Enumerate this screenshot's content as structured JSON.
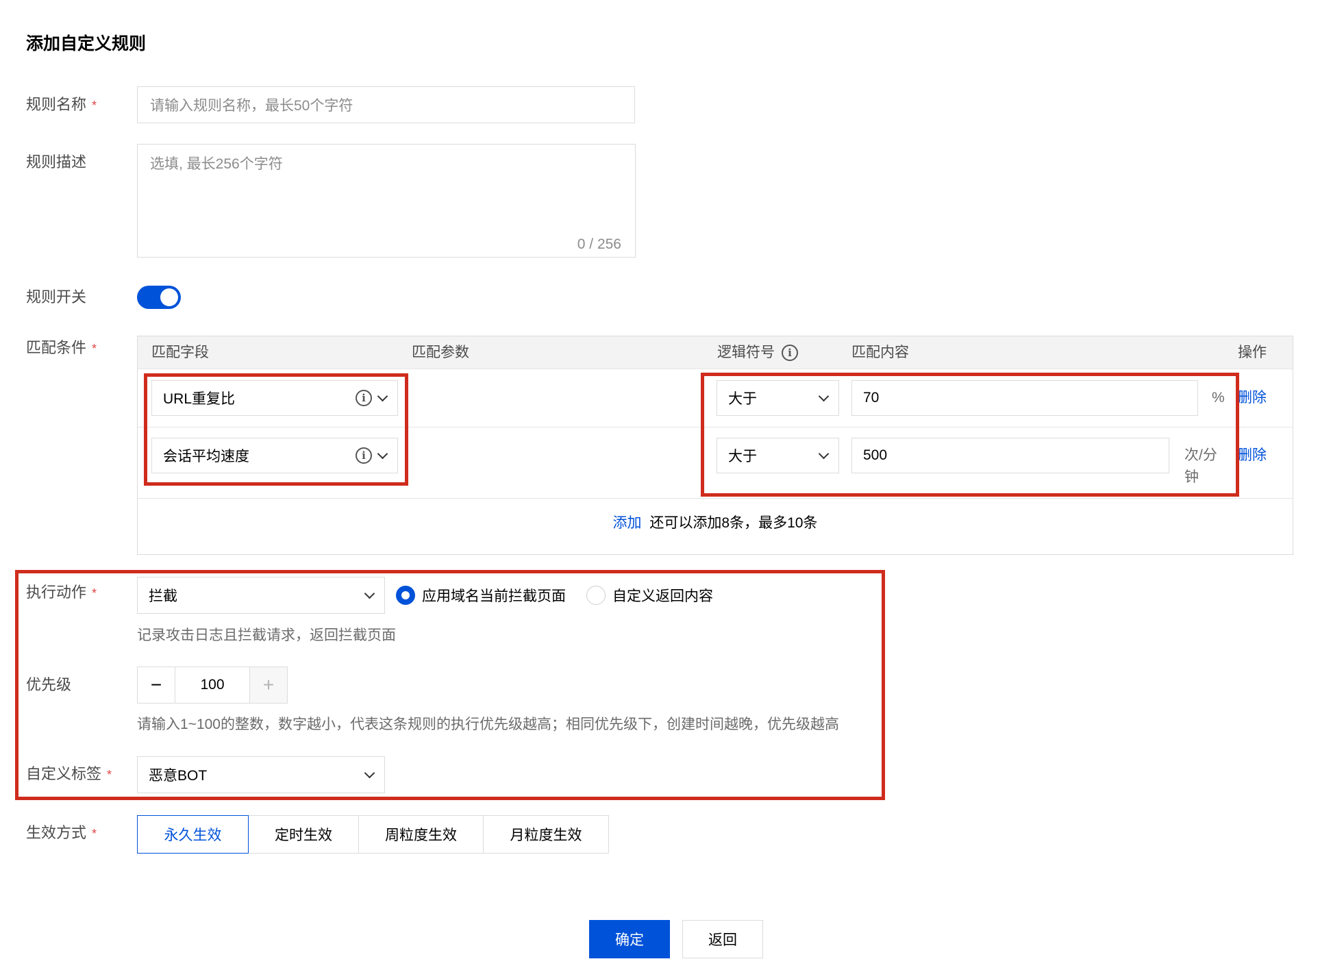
{
  "page": {
    "title": "添加自定义规则"
  },
  "form": {
    "required_mark": "*",
    "rule_name": {
      "label": "规则名称",
      "placeholder": "请输入规则名称，最长50个字符",
      "value": ""
    },
    "rule_desc": {
      "label": "规则描述",
      "placeholder": "选填, 最长256个字符",
      "counter": "0 / 256"
    },
    "rule_switch": {
      "label": "规则开关",
      "on": true
    },
    "match": {
      "label": "匹配条件",
      "columns": {
        "field": "匹配字段",
        "param": "匹配参数",
        "operator": "逻辑符号",
        "content": "匹配内容",
        "action": "操作"
      },
      "rows": [
        {
          "field": "URL重复比",
          "operator": "大于",
          "value": "70",
          "unit": "%",
          "delete": "删除"
        },
        {
          "field": "会话平均速度",
          "operator": "大于",
          "value": "500",
          "unit_line1": "次/分",
          "unit_line2": "钟",
          "delete": "删除"
        }
      ],
      "add_link": "添加",
      "add_hint": "还可以添加8条，最多10条"
    },
    "action": {
      "label": "执行动作",
      "value": "拦截",
      "radio_options": [
        {
          "label": "应用域名当前拦截页面",
          "selected": true
        },
        {
          "label": "自定义返回内容",
          "selected": false
        }
      ],
      "hint": "记录攻击日志且拦截请求，返回拦截页面"
    },
    "priority": {
      "label": "优先级",
      "minus": "−",
      "plus": "+",
      "value": "100",
      "hint": "请输入1~100的整数，数字越小，代表这条规则的执行优先级越高；相同优先级下，创建时间越晚，优先级越高"
    },
    "custom_tag": {
      "label": "自定义标签",
      "value": "恶意BOT"
    },
    "effect_mode": {
      "label": "生效方式",
      "tabs": [
        {
          "label": "永久生效",
          "active": true
        },
        {
          "label": "定时生效",
          "active": false
        },
        {
          "label": "周粒度生效",
          "active": false
        },
        {
          "label": "月粒度生效",
          "active": false
        }
      ]
    }
  },
  "footer": {
    "confirm": "确定",
    "back": "返回"
  },
  "colors": {
    "accent": "#0052d9",
    "highlight_box": "#cf2c1d",
    "required": "#e54545"
  },
  "icons": {
    "info": "info-circle-icon",
    "dropdown": "chevron-down-icon"
  }
}
